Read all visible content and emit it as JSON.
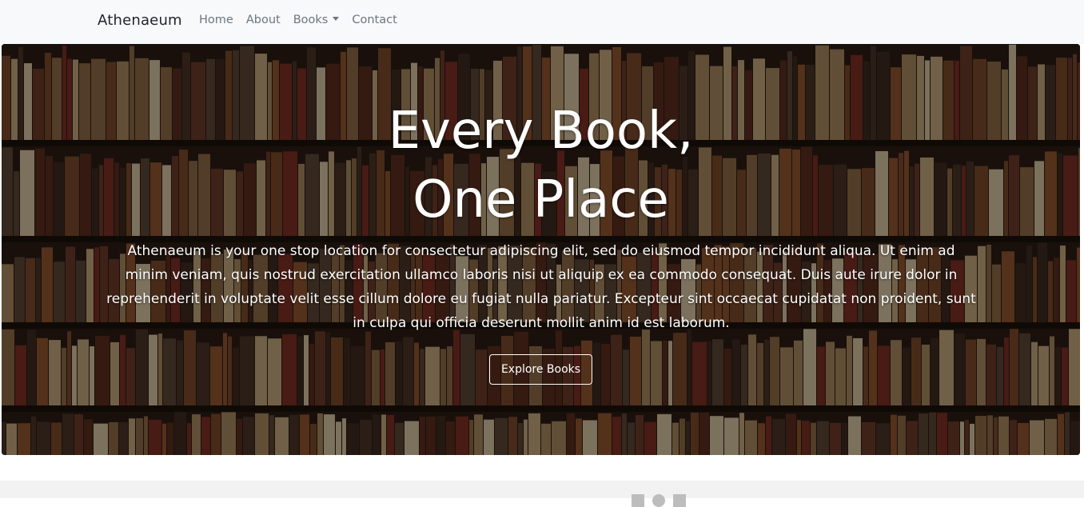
{
  "nav": {
    "brand": "Athenaeum",
    "links": [
      {
        "label": "Home"
      },
      {
        "label": "About"
      },
      {
        "label": "Books"
      },
      {
        "label": "Contact"
      }
    ]
  },
  "hero": {
    "title_line1": "Every Book,",
    "title_line2": "One Place",
    "description": "Athenaeum is your one stop location for consectetur adipiscing elit, sed do eiusmod tempor incididunt aliqua. Ut enim ad minim veniam, quis nostrud exercitation ullamco laboris nisi ut aliquip ex ea commodo consequat. Duis aute irure dolor in reprehenderit in voluptate velit esse cillum dolore eu fugiat nulla pariatur. Excepteur sint occaecat cupidatat non proident, sunt in culpa qui officia deserunt mollit anim id est laborum.",
    "button_label": "Explore Books"
  },
  "footer": {
    "social_icons": [
      "linkedin-icon",
      "github-icon",
      "twitter-icon"
    ]
  },
  "colors": {
    "navbar_bg": "#f8f9fa",
    "brand_text": "#212529",
    "nav_link": "#6c757d",
    "hero_text": "#ffffff",
    "footer_bg": "#f2f2f2"
  }
}
